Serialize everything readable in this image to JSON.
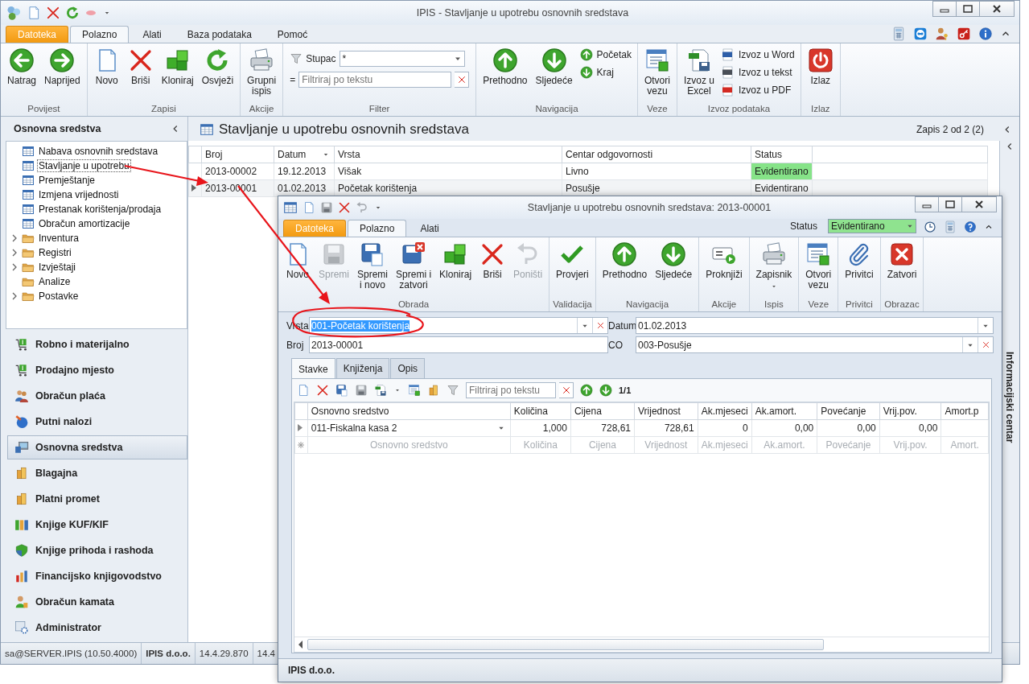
{
  "main_window": {
    "title": "IPIS - Stavljanje u upotrebu osnovnih sredstava"
  },
  "ribbon_tabs": [
    {
      "label": "Datoteka",
      "kind": "file",
      "selected": false
    },
    {
      "label": "Polazno",
      "kind": "tab",
      "selected": true
    },
    {
      "label": "Alati",
      "kind": "tab",
      "selected": false
    },
    {
      "label": "Baza podataka",
      "kind": "tab",
      "selected": false
    },
    {
      "label": "Pomoć",
      "kind": "tab",
      "selected": false
    }
  ],
  "ribbon": [
    {
      "label": "Povijest",
      "items": [
        {
          "kind": "large",
          "label": "Natrag"
        },
        {
          "kind": "large",
          "label": "Naprijed"
        }
      ]
    },
    {
      "label": "Zapisi",
      "items": [
        {
          "kind": "large",
          "label": "Novo"
        },
        {
          "kind": "large",
          "label": "Briši"
        },
        {
          "kind": "large",
          "label": "Kloniraj"
        },
        {
          "kind": "large",
          "label": "Osvježi"
        }
      ]
    },
    {
      "label": "Akcije",
      "items": [
        {
          "kind": "large",
          "label": "Grupni\nispis"
        }
      ]
    },
    {
      "label": "Filter",
      "items": [
        {
          "kind": "filter",
          "column_label": "Stupac",
          "column_value": "*",
          "operator": "=",
          "placeholder": "Filtriraj po tekstu"
        }
      ]
    },
    {
      "label": "Navigacija",
      "items": [
        {
          "kind": "large",
          "label": "Prethodno"
        },
        {
          "kind": "large",
          "label": "Sljedeće"
        },
        {
          "kind": "small",
          "label": "Početak"
        },
        {
          "kind": "small",
          "label": "Kraj"
        }
      ]
    },
    {
      "label": "Veze",
      "items": [
        {
          "kind": "large",
          "label": "Otvori\nvezu"
        }
      ]
    },
    {
      "label": "Izvoz podataka",
      "items": [
        {
          "kind": "large",
          "label": "Izvoz u\nExcel"
        },
        {
          "kind": "small",
          "label": "Izvoz u Word"
        },
        {
          "kind": "small",
          "label": "Izvoz u tekst"
        },
        {
          "kind": "small",
          "label": "Izvoz u PDF"
        }
      ]
    },
    {
      "label": "Izlaz",
      "items": [
        {
          "kind": "large",
          "label": "Izlaz"
        }
      ]
    }
  ],
  "sidebar": {
    "title": "Osnovna sredstva",
    "tree": [
      {
        "label": "Nabava osnovnih sredstava",
        "kind": "form",
        "expandable": false,
        "selected": false
      },
      {
        "label": "Stavljanje u upotrebu",
        "kind": "form",
        "expandable": false,
        "selected": true
      },
      {
        "label": "Premještanje",
        "kind": "form",
        "expandable": false,
        "selected": false
      },
      {
        "label": "Izmjena vrijednosti",
        "kind": "form",
        "expandable": false,
        "selected": false
      },
      {
        "label": "Prestanak korištenja/prodaja",
        "kind": "form",
        "expandable": false,
        "selected": false
      },
      {
        "label": "Obračun amortizacije",
        "kind": "form",
        "expandable": false,
        "selected": false
      },
      {
        "label": "Inventura",
        "kind": "folder",
        "expandable": true,
        "selected": false
      },
      {
        "label": "Registri",
        "kind": "folder",
        "expandable": true,
        "selected": false
      },
      {
        "label": "Izvještaji",
        "kind": "folder",
        "expandable": true,
        "selected": false
      },
      {
        "label": "Analize",
        "kind": "folder",
        "expandable": false,
        "selected": false
      },
      {
        "label": "Postavke",
        "kind": "folder",
        "expandable": true,
        "selected": false
      }
    ],
    "modules": [
      {
        "label": "Robno i materijalno",
        "selected": false
      },
      {
        "label": "Prodajno mjesto",
        "selected": false
      },
      {
        "label": "Obračun plaća",
        "selected": false
      },
      {
        "label": "Putni nalozi",
        "selected": false
      },
      {
        "label": "Osnovna sredstva",
        "selected": true
      },
      {
        "label": "Blagajna",
        "selected": false
      },
      {
        "label": "Platni promet",
        "selected": false
      },
      {
        "label": "Knjige KUF/KIF",
        "selected": false
      },
      {
        "label": "Knjige prihoda i rashoda",
        "selected": false
      },
      {
        "label": "Financijsko knjigovodstvo",
        "selected": false
      },
      {
        "label": "Obračun kamata",
        "selected": false
      },
      {
        "label": "Administrator",
        "selected": false
      }
    ]
  },
  "content": {
    "title": "Stavljanje u upotrebu osnovnih sredstava",
    "record_info": "Zapis 2 od 2 (2)",
    "table": {
      "columns": [
        {
          "label": "Broj",
          "kind": "text",
          "sorted": false
        },
        {
          "label": "Datum",
          "kind": "text",
          "sorted": true
        },
        {
          "label": "Vrsta",
          "kind": "text",
          "sorted": false
        },
        {
          "label": "Centar odgovornosti",
          "kind": "text",
          "sorted": false
        },
        {
          "label": "Status",
          "kind": "status",
          "sorted": false
        }
      ],
      "rows": [
        {
          "selected": false,
          "cells": [
            "2013-00002",
            "19.12.2013",
            "Višak",
            "Livno",
            "Evidentirano"
          ]
        },
        {
          "selected": true,
          "cells": [
            "2013-00001",
            "01.02.2013",
            "Početak korištenja",
            "Posušje",
            "Evidentirano"
          ]
        }
      ]
    }
  },
  "info_panel": {
    "label": "Informacijski centar"
  },
  "status_bar": [
    {
      "text": "sa@SERVER.IPIS (10.50.4000)",
      "kind": "info"
    },
    {
      "text": "IPIS d.o.o.",
      "kind": "company"
    },
    {
      "text": "14.4.29.870",
      "kind": "info"
    },
    {
      "text": "14.4",
      "kind": "info"
    }
  ],
  "child_window": {
    "title": "Stavljanje u upotrebu osnovnih sredstava: 2013-00001",
    "tabs": [
      {
        "label": "Datoteka",
        "kind": "file",
        "selected": false
      },
      {
        "label": "Polazno",
        "kind": "tab",
        "selected": true
      },
      {
        "label": "Alati",
        "kind": "tab",
        "selected": false
      }
    ],
    "status_label": "Status",
    "status_value": "Evidentirano",
    "ribbon": [
      {
        "label": "Obrada",
        "items": [
          {
            "kind": "large",
            "label": "Novo",
            "disabled": false
          },
          {
            "kind": "large",
            "label": "Spremi",
            "disabled": true
          },
          {
            "kind": "large",
            "label": "Spremi\ni novo",
            "disabled": false
          },
          {
            "kind": "large",
            "label": "Spremi i\nzatvori",
            "disabled": false
          },
          {
            "kind": "large",
            "label": "Kloniraj",
            "disabled": false
          },
          {
            "kind": "large",
            "label": "Briši",
            "disabled": false
          },
          {
            "kind": "large",
            "label": "Poništi",
            "disabled": true
          }
        ]
      },
      {
        "label": "Validacija",
        "items": [
          {
            "kind": "large",
            "label": "Provjeri",
            "disabled": false
          }
        ]
      },
      {
        "label": "Navigacija",
        "items": [
          {
            "kind": "large",
            "label": "Prethodno",
            "disabled": false
          },
          {
            "kind": "large",
            "label": "Sljedeće",
            "disabled": false
          }
        ]
      },
      {
        "label": "Akcije",
        "items": [
          {
            "kind": "large",
            "label": "Proknjiži",
            "disabled": false
          }
        ]
      },
      {
        "label": "Ispis",
        "items": [
          {
            "kind": "dropdown",
            "label": "Zapisnik",
            "disabled": false
          }
        ]
      },
      {
        "label": "Veze",
        "items": [
          {
            "kind": "large",
            "label": "Otvori\nvezu",
            "disabled": false
          }
        ]
      },
      {
        "label": "Privitci",
        "items": [
          {
            "kind": "large",
            "label": "Privitci",
            "disabled": false
          }
        ]
      },
      {
        "label": "Obrazac",
        "items": [
          {
            "kind": "large",
            "label": "Zatvori",
            "disabled": false
          }
        ]
      }
    ],
    "form": [
      {
        "label": "Vrsta",
        "value": "001-Početak korištenja",
        "kind": "lookup",
        "selected": true
      },
      {
        "label": "Datum",
        "value": "01.02.2013",
        "kind": "date",
        "selected": false
      },
      {
        "label": "Broj",
        "value": "2013-00001",
        "kind": "text",
        "selected": false
      },
      {
        "label": "CO",
        "value": "003-Posušje",
        "kind": "lookup",
        "selected": false
      }
    ],
    "detail_tabs": [
      {
        "label": "Stavke",
        "selected": true
      },
      {
        "label": "Knjiženja",
        "selected": false
      },
      {
        "label": "Opis",
        "selected": false
      }
    ],
    "toolbar": {
      "filter_placeholder": "Filtriraj po tekstu",
      "page": "1/1"
    },
    "grid": {
      "columns": [
        {
          "label": "Osnovno sredstvo",
          "kind": "lookup"
        },
        {
          "label": "Količina",
          "kind": "number"
        },
        {
          "label": "Cijena",
          "kind": "number"
        },
        {
          "label": "Vrijednost",
          "kind": "number"
        },
        {
          "label": "Ak.mjeseci",
          "kind": "number"
        },
        {
          "label": "Ak.amort.",
          "kind": "number"
        },
        {
          "label": "Povećanje",
          "kind": "number"
        },
        {
          "label": "Vrij.pov.",
          "kind": "number"
        },
        {
          "label": "Amort.p",
          "kind": "number"
        }
      ],
      "rows": [
        {
          "cells": [
            "011-Fiskalna kasa 2",
            "1,000",
            "728,61",
            "728,61",
            "0",
            "0,00",
            "0,00",
            "0,00",
            ""
          ]
        }
      ],
      "new_row": [
        "Osnovno sredstvo",
        "Količina",
        "Cijena",
        "Vrijednost",
        "Ak.mjeseci",
        "Ak.amort.",
        "Povećanje",
        "Vrij.pov.",
        "Amort."
      ]
    },
    "status_bar": "IPIS d.o.o."
  }
}
